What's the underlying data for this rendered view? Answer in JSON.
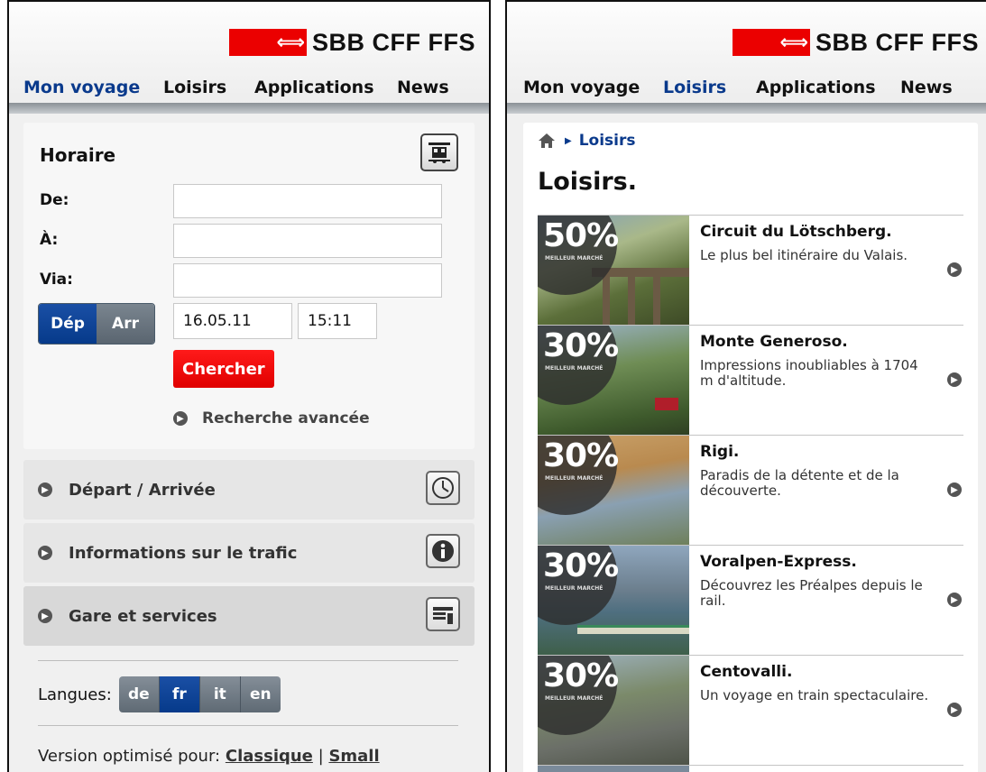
{
  "brand": {
    "arrows": "⟺",
    "name": "SBB CFF FFS"
  },
  "nav": [
    {
      "label": "Mon voyage"
    },
    {
      "label": "Loisirs"
    },
    {
      "label": "Applications"
    },
    {
      "label": "News"
    }
  ],
  "left": {
    "active_nav": "Mon voyage",
    "horaire": {
      "title": "Horaire",
      "from_label": "De:",
      "to_label": "À:",
      "via_label": "Via:",
      "from_value": "",
      "to_value": "",
      "via_value": "",
      "dep_label": "Dép",
      "arr_label": "Arr",
      "date": "16.05.11",
      "time": "15:11",
      "search_label": "Chercher",
      "advanced_label": "Recherche avancée"
    },
    "accordion": [
      {
        "label": "Départ / Arrivée",
        "icon": "clock-icon"
      },
      {
        "label": "Informations sur le trafic",
        "icon": "info-icon"
      },
      {
        "label": "Gare et services",
        "icon": "station-services-icon"
      }
    ],
    "languages": {
      "label": "Langues:",
      "options": [
        "de",
        "fr",
        "it",
        "en"
      ],
      "selected": "fr"
    },
    "version": {
      "label": "Version optimisé pour:",
      "classic": "Classique",
      "separator": "|",
      "small": "Small"
    }
  },
  "right": {
    "active_nav": "Loisirs",
    "breadcrumb": {
      "current": "Loisirs"
    },
    "page_title": "Loisirs.",
    "badge_caption": "MEILLEUR MARCHÉ",
    "items": [
      {
        "badge": "50%",
        "title": "Circuit du Lötschberg.",
        "desc": "Le plus bel itinéraire du Valais."
      },
      {
        "badge": "30%",
        "title": "Monte Generoso.",
        "desc": "Impressions inoubliables à 1704 m d'altitude."
      },
      {
        "badge": "30%",
        "title": "Rigi.",
        "desc": "Paradis de la détente et de la découverte."
      },
      {
        "badge": "30%",
        "title": "Voralpen-Express.",
        "desc": "Découvrez les Préalpes depuis le rail."
      },
      {
        "badge": "30%",
        "title": "Centovalli.",
        "desc": "Un voyage en train spectaculaire."
      }
    ]
  },
  "colors": {
    "sbb_red": "#eb0000",
    "nav_active": "#0a3a8c",
    "button_red": "#e00000"
  }
}
